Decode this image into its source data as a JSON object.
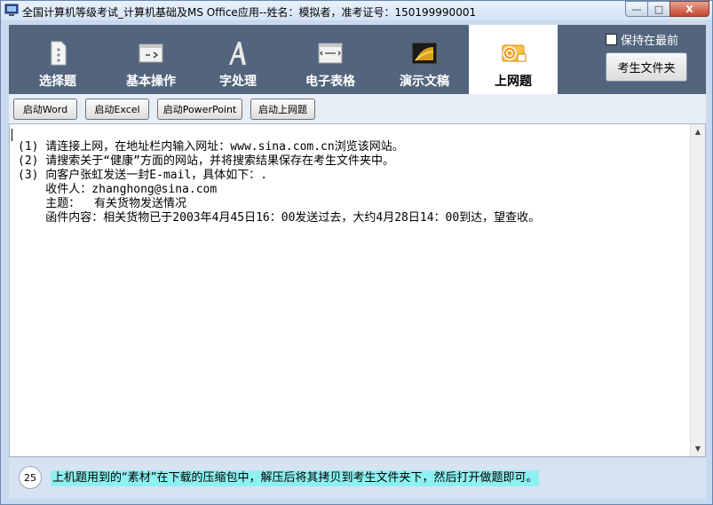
{
  "window": {
    "title": "全国计算机等级考试_计算机基础及MS Office应用--姓名：模拟者，准考证号：150199990001",
    "controls": {
      "minimize": "—",
      "maximize": "□",
      "close": "X"
    }
  },
  "tabs": [
    {
      "label": "选择题",
      "icon": "document-icon",
      "active": false
    },
    {
      "label": "基本操作",
      "icon": "window-operation-icon",
      "active": false
    },
    {
      "label": "字处理",
      "icon": "letter-a-icon",
      "active": false
    },
    {
      "label": "电子表格",
      "icon": "spreadsheet-icon",
      "active": false
    },
    {
      "label": "演示文稿",
      "icon": "presentation-icon",
      "active": false
    },
    {
      "label": "上网题",
      "icon": "outlook-icon",
      "active": true
    }
  ],
  "options": {
    "always_on_top_label": "保持在最前",
    "always_on_top_checked": false,
    "folder_button": "考生文件夹"
  },
  "launch_buttons": [
    "启动Word",
    "启动Excel",
    "启动PowerPoint",
    "启动上网题"
  ],
  "content": {
    "lines": [
      "(1) 请连接上网，在地址栏内输入网址：www.sina.com.cn浏览该网站。",
      "(2) 请搜索关于“健康”方面的网站，并将搜索结果保存在考生文件夹中。",
      "(3) 向客户张虹发送一封E-mail，具体如下：.",
      "    收件人：zhanghong@sina.com",
      "    主题：  有关货物发送情况",
      "    函件内容：相关货物已于2003年4月45日16：00发送过去，大约4月28日14：00到达，望查收。"
    ]
  },
  "footer": {
    "counter": "25",
    "hint": "上机题用到的“素材”在下载的压缩包中，解压后将其拷贝到考生文件夹下，然后打开做题即可。"
  },
  "colors": {
    "toolbar_bg": "#53657e",
    "hint_highlight": "#8ef0f0",
    "window_bg": "#c9d9ee"
  }
}
